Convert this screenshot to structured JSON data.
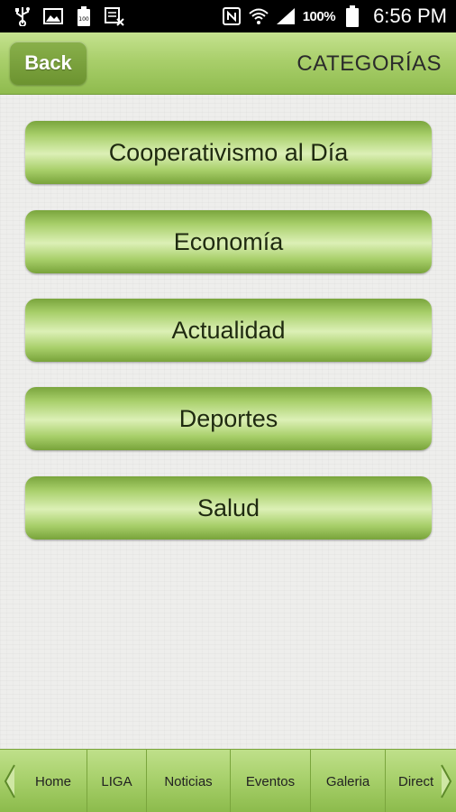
{
  "status_bar": {
    "battery_percent": "100%",
    "time": "6:56 PM",
    "icons": [
      "usb-icon",
      "image-icon",
      "battery-100-icon",
      "calendar-x-icon",
      "nfc-icon",
      "wifi-icon",
      "signal-icon",
      "battery-icon"
    ]
  },
  "header": {
    "back_label": "Back",
    "title": "CATEGORÍAS"
  },
  "categories": [
    {
      "label": "Cooperativismo al Día"
    },
    {
      "label": "Economía"
    },
    {
      "label": "Actualidad"
    },
    {
      "label": "Deportes"
    },
    {
      "label": "Salud"
    }
  ],
  "bottom_nav": {
    "items": [
      {
        "label": "Home"
      },
      {
        "label": "LIGA"
      },
      {
        "label": "Noticias"
      },
      {
        "label": "Eventos"
      },
      {
        "label": "Galeria"
      },
      {
        "label": "Direct"
      }
    ]
  },
  "colors": {
    "header_green": "#a9cf6b",
    "back_button": "#76a03a",
    "button_highlight": "#dcf0b6",
    "background": "#eeeeec"
  }
}
